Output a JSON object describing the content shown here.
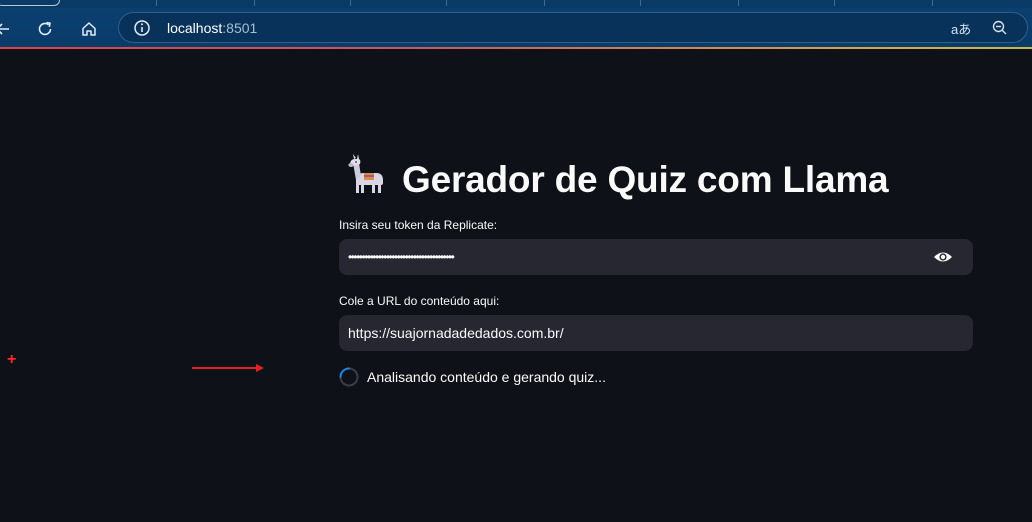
{
  "browser": {
    "url_host": "localhost",
    "url_port": ":8501",
    "translate_glyph": "aあ"
  },
  "page": {
    "title": "Gerador de Quiz com Llama",
    "title_emoji": "🦙",
    "token_label": "Insira seu token da Replicate:",
    "token_value": "•••••••••••••••••••••••••••••••••••••••",
    "url_label": "Cole a URL do conteúdo aqui:",
    "url_value": "https://suajornadadedados.com.br/",
    "status_text": "Analisando conteúdo e gerando quiz..."
  },
  "annotations": {
    "plus_marker": "+"
  },
  "colors": {
    "background": "#0e1117",
    "input_bg": "#262730",
    "browser_toolbar": "#0b3f6f",
    "spinner_accent": "#1c83e1",
    "annotation_red": "#ff2b2b"
  }
}
